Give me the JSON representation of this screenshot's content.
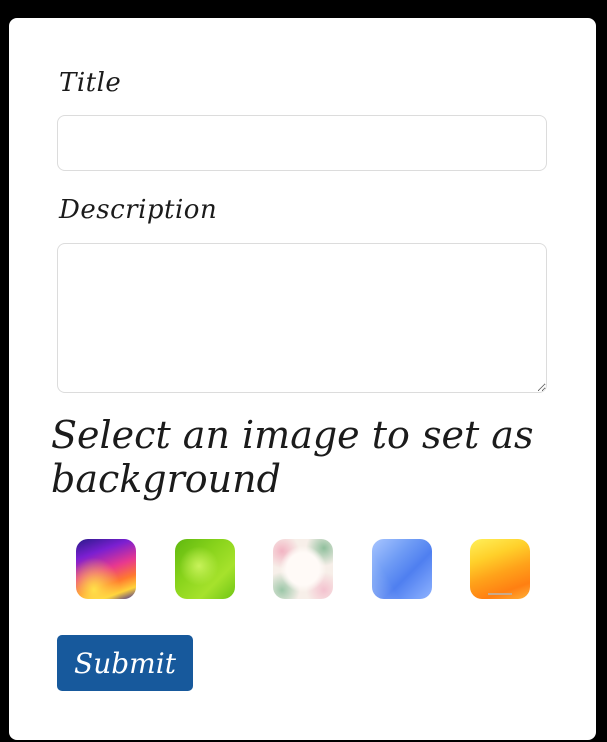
{
  "form": {
    "title_label": "Title",
    "title_value": "",
    "title_placeholder": "",
    "description_label": "Description",
    "description_value": "",
    "description_placeholder": "",
    "background_heading": "Select an image to set as background",
    "submit_label": "Submit"
  },
  "backgrounds": [
    {
      "icon": "colorful-waves-thumbnail"
    },
    {
      "icon": "green-bokeh-thumbnail"
    },
    {
      "icon": "floral-frame-thumbnail"
    },
    {
      "icon": "blue-polygon-thumbnail"
    },
    {
      "icon": "orange-waves-thumbnail"
    }
  ],
  "colors": {
    "page_background": "#000000",
    "card_background": "#ffffff",
    "text": "#1b1b1b",
    "input_border": "#dcdcdc",
    "submit_button": "#17599c",
    "submit_text": "#ffffff"
  }
}
